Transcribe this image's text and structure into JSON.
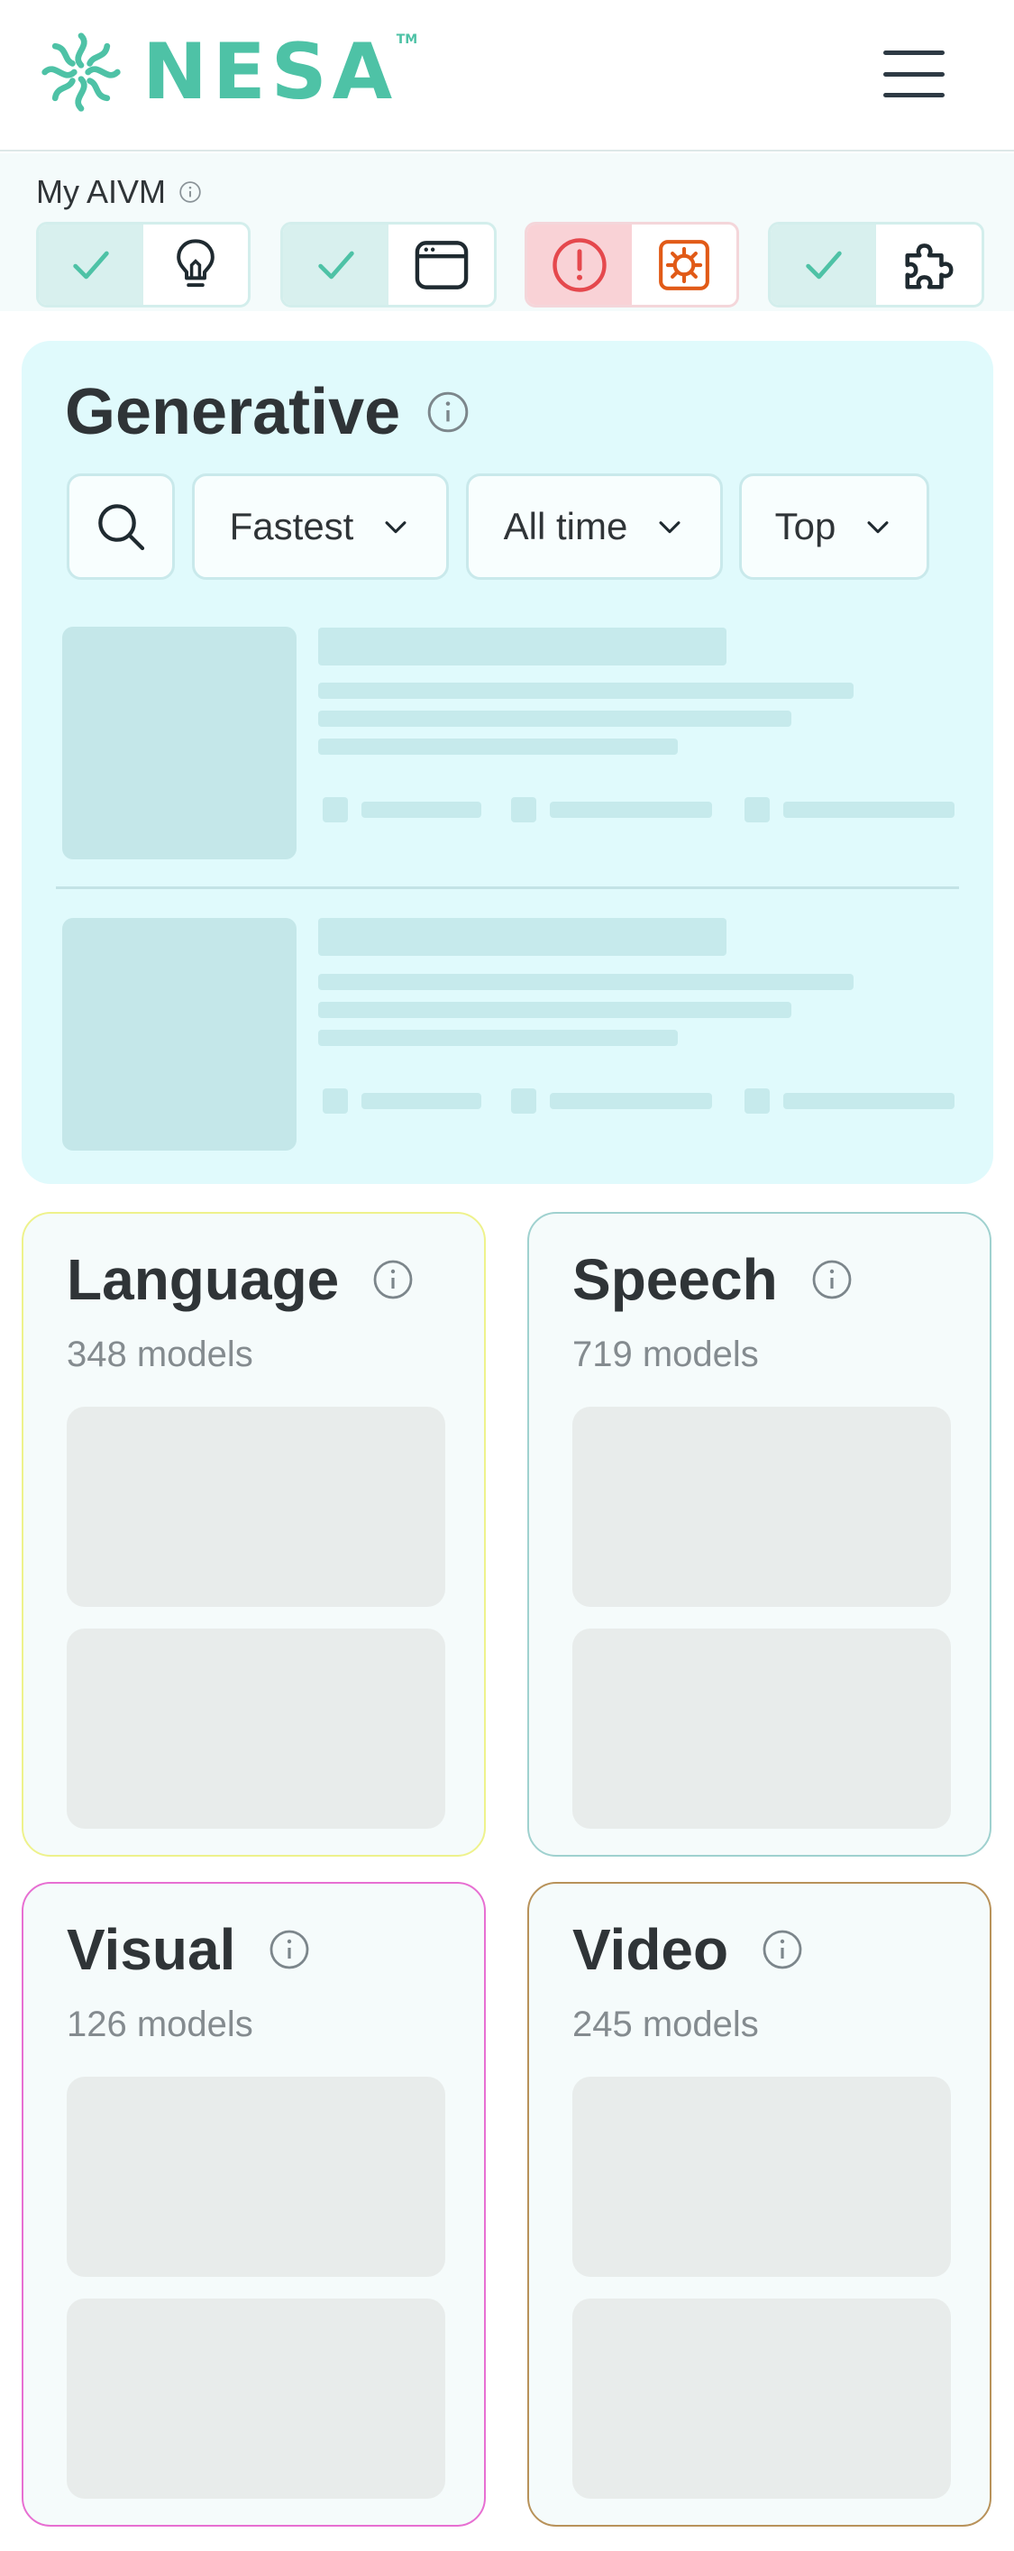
{
  "brand": {
    "name": "NESA",
    "trademark": "TM",
    "color": "#4ec2a6"
  },
  "header": {
    "menu_icon": "hamburger-menu-icon"
  },
  "aivm": {
    "label": "My AIVM",
    "info_icon": "info-icon",
    "items": [
      {
        "status": "ok",
        "status_icon": "check-icon",
        "icon": "lightbulb-icon"
      },
      {
        "status": "ok",
        "status_icon": "check-icon",
        "icon": "browser-window-icon"
      },
      {
        "status": "error",
        "status_icon": "alert-circle-icon",
        "icon": "bug-icon"
      },
      {
        "status": "ok",
        "status_icon": "check-icon",
        "icon": "puzzle-icon"
      }
    ]
  },
  "generative": {
    "title": "Generative",
    "filters": {
      "search_icon": "search-icon",
      "speed": "Fastest",
      "period": "All time",
      "sort": "Top"
    },
    "accent": "#e0fafc"
  },
  "categories": [
    {
      "title": "Language",
      "count": "348 models",
      "border": "#eef28c"
    },
    {
      "title": "Speech",
      "count": "719 models",
      "border": "#9fd1cf"
    },
    {
      "title": "Visual",
      "count": "126 models",
      "border": "#e76fd2"
    },
    {
      "title": "Video",
      "count": "245 models",
      "border": "#b8925a"
    }
  ]
}
